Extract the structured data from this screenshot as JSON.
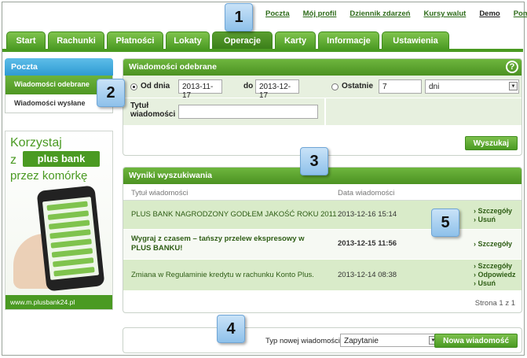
{
  "top_links": [
    "Poczta",
    "Mój profil",
    "Dziennik zdarzeń",
    "Kursy walut",
    "Demo",
    "Pomoc"
  ],
  "tabs": [
    "Start",
    "Rachunki",
    "Płatności",
    "Lokaty",
    "Operacje",
    "Karty",
    "Informacje",
    "Ustawienia"
  ],
  "active_tab": "Operacje",
  "sidebar": {
    "title": "Poczta",
    "items": [
      "Wiadomości odebrane",
      "Wiadomości wysłane"
    ]
  },
  "promo": {
    "line1": "Korzystaj",
    "z": "z",
    "logo": "plus bank",
    "line2": "przez komórkę",
    "url": "www.m.plusbank24.pl"
  },
  "search_panel": {
    "title": "Wiadomości odebrane",
    "help": "?",
    "from_label": "Od dnia",
    "from_value": "2013-11-17",
    "to_label": "do",
    "to_value": "2013-12-17",
    "last_label": "Ostatnie",
    "last_value": "7",
    "unit_value": "dni",
    "title_label": "Tytuł wiadomości",
    "title_value": "",
    "search_button": "Wyszukaj"
  },
  "results": {
    "title": "Wyniki wyszukiwania",
    "col_title": "Tytuł wiadomości",
    "col_date": "Data wiadomości",
    "rows": [
      {
        "title": "PLUS BANK NAGRODZONY GODŁEM JAKOŚĆ ROKU 2011",
        "date": "2013-12-16 15:14",
        "actions": [
          "Szczegóły",
          "Usuń"
        ]
      },
      {
        "title": "Wygraj z czasem – tańszy przelew ekspresowy w PLUS BANKU!",
        "date": "2013-12-15 11:56",
        "actions": [
          "Szczegóły"
        ]
      },
      {
        "title": "Zmiana w Regulaminie kredytu w rachunku Konto Plus.",
        "date": "2013-12-14 08:38",
        "actions": [
          "Szczegóły",
          "Odpowiedz",
          "Usuń"
        ]
      }
    ],
    "pager": "Strona 1 z 1"
  },
  "new_message": {
    "label": "Typ nowej wiadomości",
    "type_value": "Zapytanie",
    "button": "Nowa wiadomość"
  },
  "callouts": [
    "1",
    "2",
    "3",
    "4",
    "5"
  ],
  "colors": {
    "brand_green": "#4a9a22",
    "row_highlight": "#d9ebc9",
    "sidebar_head": "#2f9bd3"
  }
}
